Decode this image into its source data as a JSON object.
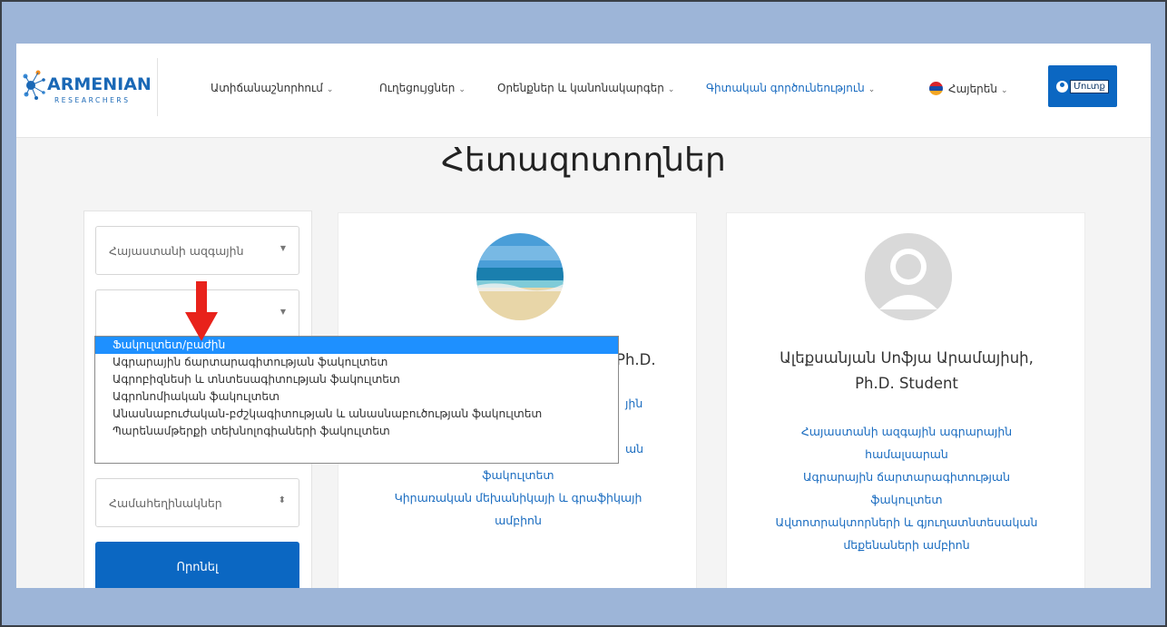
{
  "header": {
    "logo_main": "ARMENIAN",
    "logo_sub": "RESEARCHERS",
    "nav": [
      {
        "label": "Ատիճանաշնորհում",
        "active": false
      },
      {
        "label": "Ուղեցույցներ",
        "active": false
      },
      {
        "label": "Օրենքներ և կանոնակարգեր",
        "active": false
      },
      {
        "label": "Գիտական գործունեություն",
        "active": true
      }
    ],
    "language": "Հայերեն",
    "login_label": "Մուտք"
  },
  "page_title": "Հետազոտողներ",
  "filters": {
    "university_value": "Հայաստանի ազգային",
    "faculty_value": "",
    "degree_value": "Համահեղինակներ",
    "search_label": "Որոնել"
  },
  "faculty_dropdown": {
    "options": [
      "Ֆակուլտետ/բաժին",
      "Ագրարային ճարտարագիտության ֆակուլտետ",
      "Ագրոբիզնեսի և տնտեսագիտության ֆակուլտետ",
      "Ագրոնոմիական ֆակուլտետ",
      "Անասնաբուժական-բժշկագիտության և անասնաբուծության ֆակուլտետ",
      "Պարենամթերքի տեխնոլոգիաների ֆակուլտետ"
    ],
    "selected_index": 0
  },
  "cards": [
    {
      "name_partial": "Ph.D.",
      "link_partial_1": "յին",
      "link_partial_2": "ան",
      "links": [
        "ֆակուլտետ",
        "Կիրառական մեխանիկայի և գրաֆիկայի",
        "ամբիոն"
      ]
    },
    {
      "name_line1": "Ալեքսանյան Սոֆյա Արամայիսի,",
      "name_line2": "Ph.D. Student",
      "links": [
        "Հայաստանի ազգային ագրարային",
        "համալսարան",
        "Ագրարային ճարտարագիտության",
        "ֆակուլտետ",
        "Ավտոտրակտորների և գյուղատնտեսական",
        "մեքենաների ամբիոն"
      ]
    }
  ],
  "colors": {
    "primary": "#0b67c2",
    "link": "#1a6cc0",
    "selected_option": "#1e90ff",
    "annotation_arrow": "#e8221b",
    "backdrop": "#9db5d8"
  }
}
